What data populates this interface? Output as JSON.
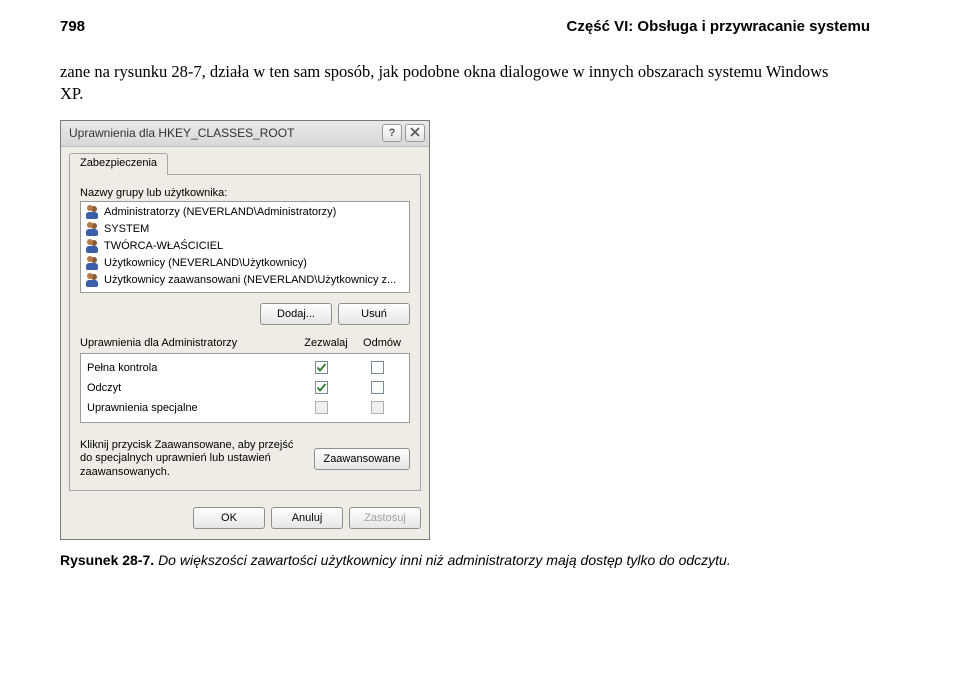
{
  "page": {
    "number": "798",
    "section": "Część VI: Obsługa i przywracanie systemu"
  },
  "body_paragraph": "zane na rysunku 28-7, działa w ten sam sposób, jak podobne okna dialogowe w innych obszarach systemu Windows XP.",
  "dialog": {
    "title": "Uprawnienia dla HKEY_CLASSES_ROOT",
    "tab": "Zabezpieczenia",
    "groups_label": "Nazwy grupy lub użytkownika:",
    "list": [
      "Administratorzy (NEVERLAND\\Administratorzy)",
      "SYSTEM",
      "TWÓRCA-WŁAŚCICIEL",
      "Użytkownicy (NEVERLAND\\Użytkownicy)",
      "Użytkownicy zaawansowani (NEVERLAND\\Użytkownicy z..."
    ],
    "add_button": "Dodaj...",
    "remove_button": "Usuń",
    "perm_label": "Uprawnienia dla Administratorzy",
    "col_allow": "Zezwalaj",
    "col_deny": "Odmów",
    "perms": [
      {
        "name": "Pełna kontrola",
        "allow": true,
        "deny": false,
        "allow_disabled": false,
        "deny_disabled": false
      },
      {
        "name": "Odczyt",
        "allow": true,
        "deny": false,
        "allow_disabled": false,
        "deny_disabled": false
      },
      {
        "name": "Uprawnienia specjalne",
        "allow": false,
        "deny": false,
        "allow_disabled": true,
        "deny_disabled": true
      }
    ],
    "advanced_text": "Kliknij przycisk Zaawansowane, aby przejść do specjalnych uprawnień lub ustawień zaawansowanych.",
    "advanced_button": "Zaawansowane",
    "ok": "OK",
    "cancel": "Anuluj",
    "apply": "Zastosuj"
  },
  "caption": {
    "num": "Rysunek 28-7.",
    "text": "Do większości zawartości użytkownicy inni niż administratorzy mają dostęp tylko do odczytu."
  }
}
